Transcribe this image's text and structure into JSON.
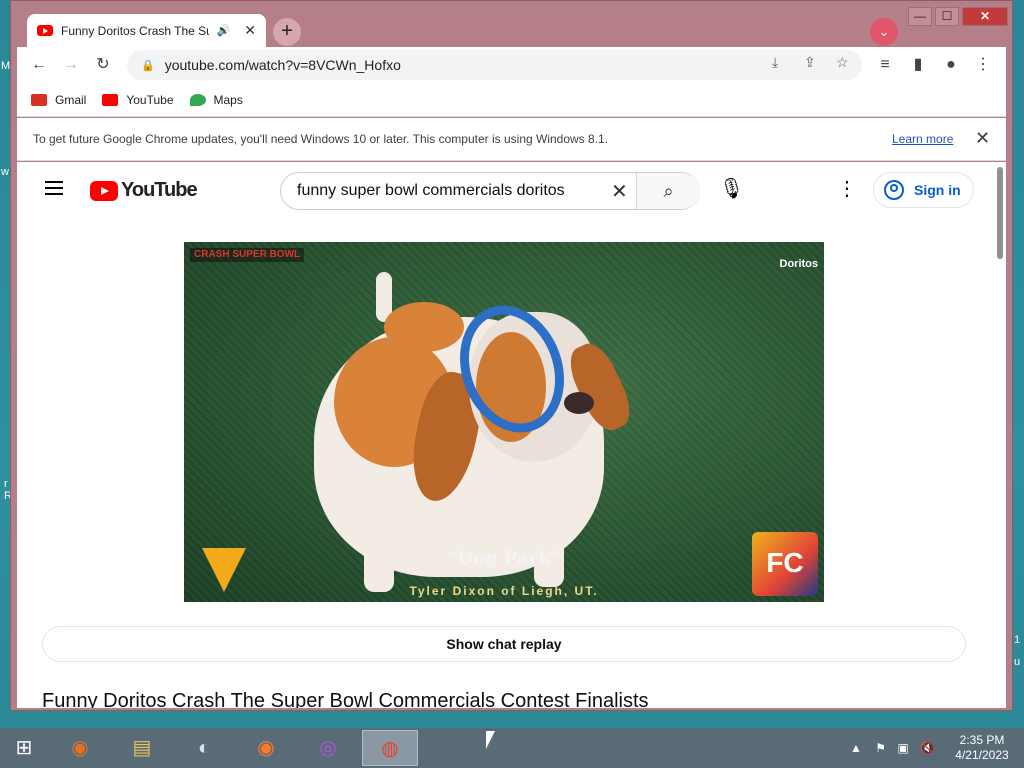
{
  "browser": {
    "tab_title": "Funny Doritos Crash The Sup",
    "tab_audio": "🔊",
    "new_tab": "+",
    "url": "youtube.com/watch?v=8VCWn_Hofxo",
    "window_controls": [
      "—",
      "☐",
      "✕"
    ]
  },
  "bookmarks": [
    {
      "label": "Gmail",
      "color": "#d93025"
    },
    {
      "label": "YouTube",
      "color": "#ff0000"
    },
    {
      "label": "Maps",
      "color": "#34a853"
    }
  ],
  "infobar": {
    "text": "To get future Google Chrome updates, you'll need Windows 10 or later. This computer is using Windows 8.1.",
    "learn_more": "Learn more",
    "close": "✕"
  },
  "youtube": {
    "logo_text": "YouTube",
    "search_value": "funny super bowl commercials doritos",
    "sign_in": "Sign in"
  },
  "video": {
    "overlay_top_left": "CRASH SUPER BOWL",
    "overlay_top_right": "Doritos",
    "caption_title": "“Dog Park”",
    "caption_sub": "Tyler Dixon of Liegh, UT.",
    "badge": "FC"
  },
  "page": {
    "chat_replay": "Show chat replay",
    "video_title": "Funny Doritos Crash The Super Bowl Commercials Contest Finalists"
  },
  "taskbar": {
    "time": "2:35 PM",
    "date": "4/21/2023"
  },
  "desktop_fragments": [
    "M",
    "w",
    "r",
    "R",
    "1",
    "u"
  ]
}
